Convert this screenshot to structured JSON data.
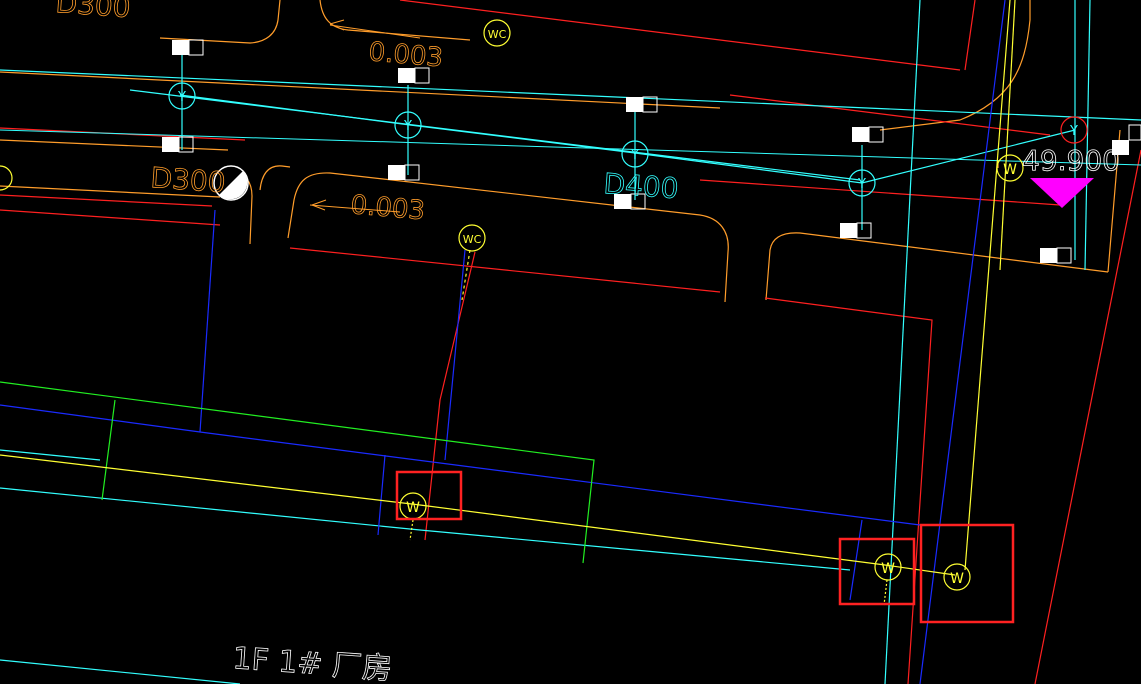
{
  "drawing": {
    "labels": {
      "d300_top": "D300",
      "d300_mid": "D300",
      "d400": "D400",
      "slope_top": "0.003",
      "slope_mid": "0.003",
      "elevation": "49.900",
      "building": "1F  1# 厂房"
    },
    "nodes": {
      "wc": "WC",
      "y": "Y",
      "w": "W"
    },
    "colors": {
      "background": "#000000",
      "orange": "#ff9d2b",
      "red": "#ff2020",
      "cyan": "#33ffff",
      "blue": "#1a2bff",
      "green": "#22ee22",
      "yellow": "#ffff33",
      "white": "#ffffff",
      "magenta": "#ff00ff",
      "highlight": "#ff2222"
    }
  }
}
